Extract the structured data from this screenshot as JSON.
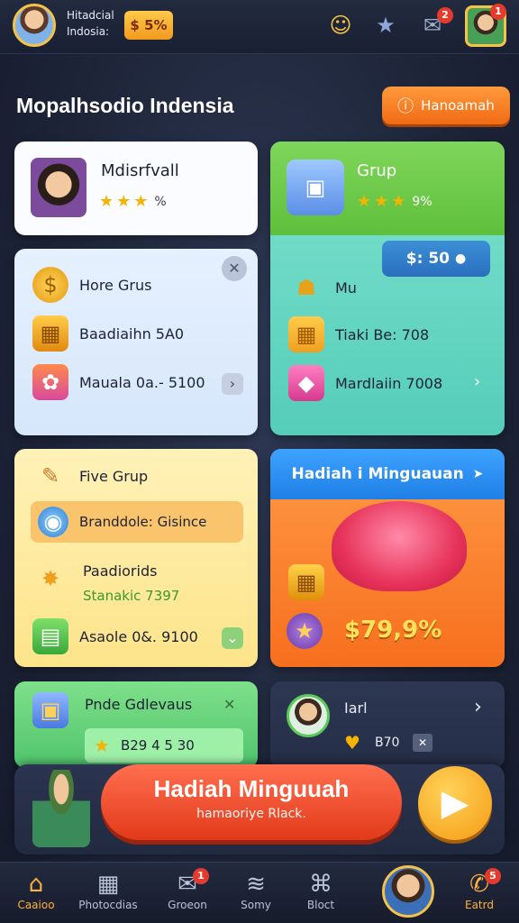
{
  "header": {
    "player_name_line1": "Hitadcial",
    "player_name_line2": "Indosia:",
    "coins": "$ 5%",
    "icons": [
      "smile-icon",
      "star-badge-icon",
      "mail-icon",
      "profile-icon"
    ],
    "mail_badge": "2",
    "profile_badge": "1"
  },
  "page": {
    "title": "Mopalhsodio Indensia",
    "action_button": "Hanoamah"
  },
  "cards": {
    "profile": {
      "name": "Mdisrfvall",
      "rating_text": "%"
    },
    "grup": {
      "title": "Grup",
      "rating_text": "9%",
      "price": "$: 50"
    },
    "list_left": {
      "items": [
        {
          "label": "Hore Grus"
        },
        {
          "label": "Baadiaihn 5A0"
        },
        {
          "label": "Mauala 0a.- 5100"
        }
      ]
    },
    "list_right": {
      "items": [
        {
          "label": "Mu"
        },
        {
          "label": "Tiaki Be: 708"
        },
        {
          "label": "Mardlaiin 7008"
        }
      ]
    },
    "five_grup": {
      "title": "Five Grup",
      "highlight": "Branddole: Gisince",
      "item1_title": "Paadiorids",
      "item1_sub": "Stanakic 7397",
      "item2": "Asaole 0&. 9100"
    },
    "weekly": {
      "title": "Hadiah i Minguauan",
      "amount": "$79,9%"
    },
    "bonus": {
      "title": "Pnde Gdlevaus",
      "value": "B29 4 5 30"
    },
    "friend": {
      "name": "Iarl",
      "value": "B70"
    }
  },
  "banner": {
    "title": "Hadiah Minguuah",
    "subtitle": "hamaoriye Rlack."
  },
  "nav": {
    "items": [
      {
        "label": "Caaioo",
        "icon": "home-icon"
      },
      {
        "label": "Photocdias",
        "icon": "grid-icon"
      },
      {
        "label": "Groeon",
        "icon": "mail-icon",
        "badge": "1"
      },
      {
        "label": "Somy",
        "icon": "layers-icon"
      },
      {
        "label": "Bloct",
        "icon": "shop-icon"
      },
      {
        "label": "Eatrd",
        "icon": "chat-icon",
        "badge": "5"
      }
    ]
  }
}
